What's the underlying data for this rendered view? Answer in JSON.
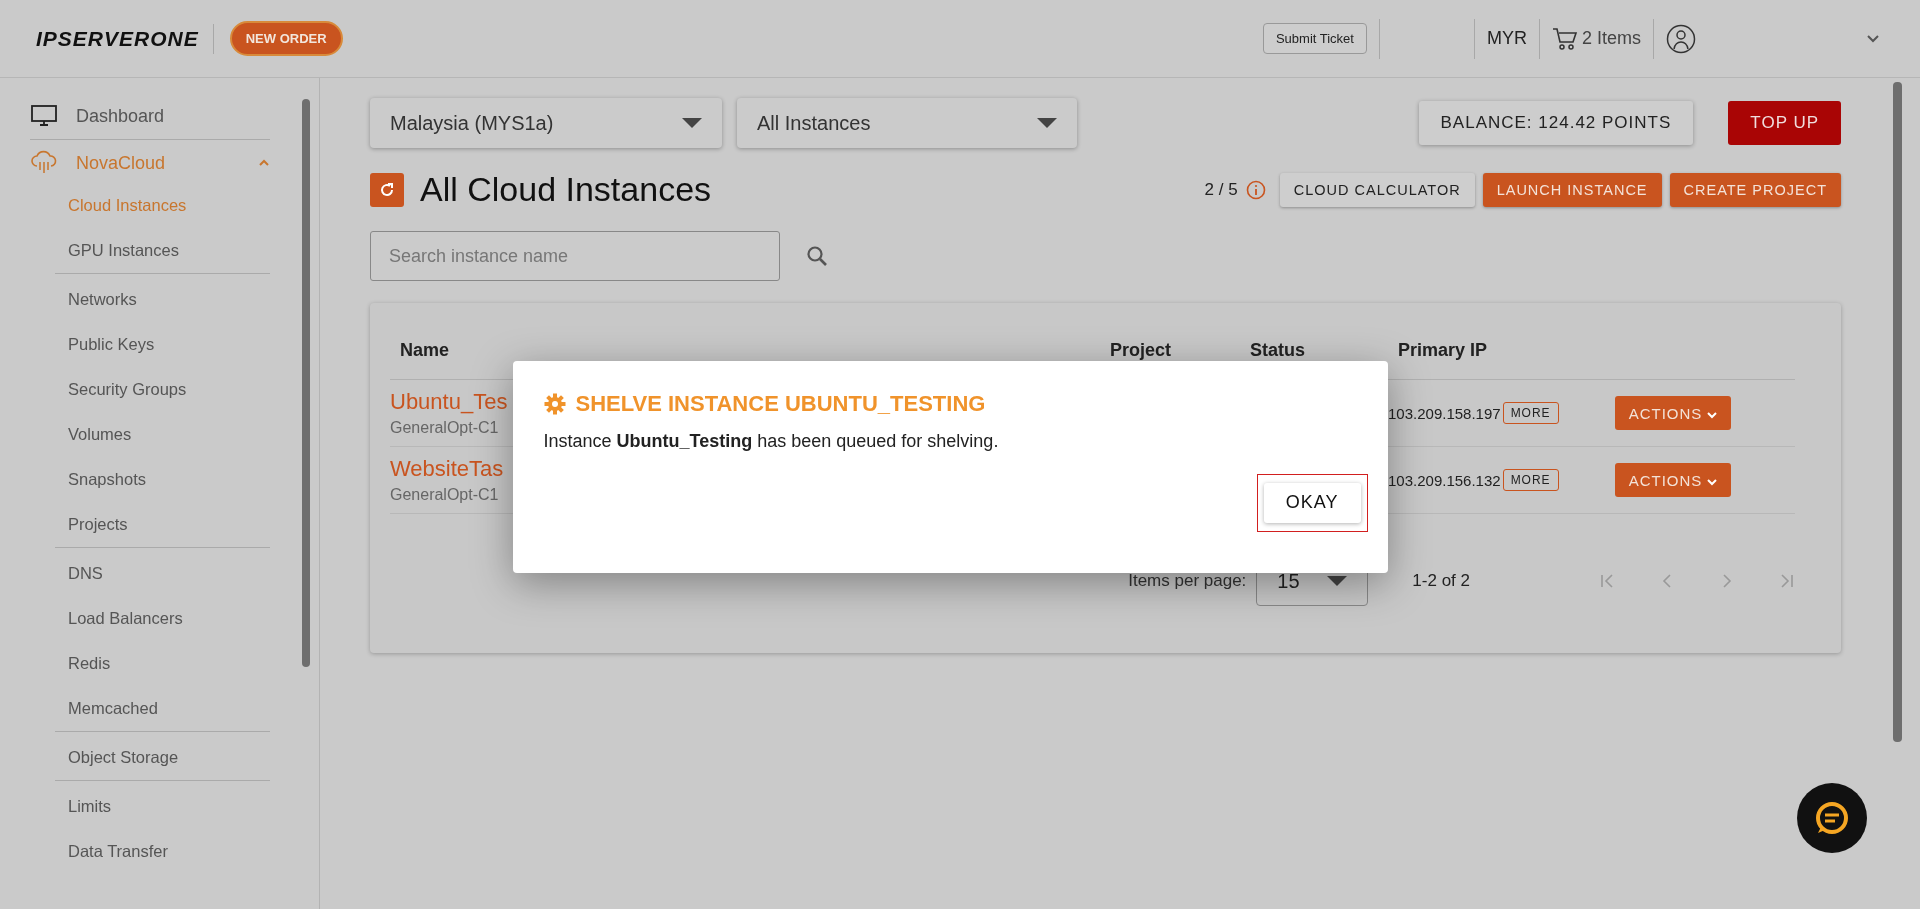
{
  "header": {
    "logo": "IPSERVERONE",
    "new_order": "NEW ORDER",
    "submit_ticket": "Submit Ticket",
    "currency": "MYR",
    "cart": "2 Items"
  },
  "sidebar": {
    "items": [
      {
        "label": "Dashboard",
        "selected": false
      },
      {
        "label": "NovaCloud",
        "expanded": true,
        "selected": true,
        "children": [
          {
            "label": "Cloud Instances",
            "selected": true,
            "divider_after": false
          },
          {
            "label": "GPU Instances",
            "selected": false,
            "divider_after": true
          },
          {
            "label": "Networks",
            "selected": false,
            "divider_after": false
          },
          {
            "label": "Public Keys",
            "selected": false,
            "divider_after": false
          },
          {
            "label": "Security Groups",
            "selected": false,
            "divider_after": false
          },
          {
            "label": "Volumes",
            "selected": false,
            "divider_after": false
          },
          {
            "label": "Snapshots",
            "selected": false,
            "divider_after": false
          },
          {
            "label": "Projects",
            "selected": false,
            "divider_after": true
          },
          {
            "label": "DNS",
            "selected": false,
            "divider_after": false
          },
          {
            "label": "Load Balancers",
            "selected": false,
            "divider_after": false
          },
          {
            "label": "Redis",
            "selected": false,
            "divider_after": false
          },
          {
            "label": "Memcached",
            "selected": false,
            "divider_after": true
          },
          {
            "label": "Object Storage",
            "selected": false,
            "divider_after": true
          },
          {
            "label": "Limits",
            "selected": false,
            "divider_after": false
          },
          {
            "label": "Data Transfer",
            "selected": false,
            "divider_after": false
          }
        ]
      }
    ]
  },
  "filters": {
    "region": "Malaysia (MYS1a)",
    "instances": "All Instances"
  },
  "balance": "BALANCE: 124.42 POINTS",
  "top_up": "TOP UP",
  "title": "All Cloud Instances",
  "quota": "2 / 5",
  "actions": [
    "CLOUD CALCULATOR",
    "LAUNCH INSTANCE",
    "CREATE PROJECT"
  ],
  "search": {
    "placeholder": "Search instance name"
  },
  "table": {
    "columns": [
      "Name",
      "Project",
      "Status",
      "Primary IP"
    ],
    "rows": [
      {
        "name": "Ubuntu_Tes",
        "flavor": "GeneralOpt-C1",
        "ip": "103.209.158.197",
        "more": "MORE",
        "actions": "ACTIONS"
      },
      {
        "name": "WebsiteTas",
        "flavor": "GeneralOpt-C1",
        "ip": "103.209.156.132",
        "more": "MORE",
        "actions": "ACTIONS"
      }
    ]
  },
  "pagination": {
    "label": "Items per page:",
    "value": "15",
    "range": "1-2 of 2"
  },
  "dialog": {
    "title": "SHELVE INSTANCE UBUNTU_TESTING",
    "message": "Instance **Ubuntu_Testing** has been queued for shelving.",
    "button": "OKAY",
    "button_focused": true
  }
}
